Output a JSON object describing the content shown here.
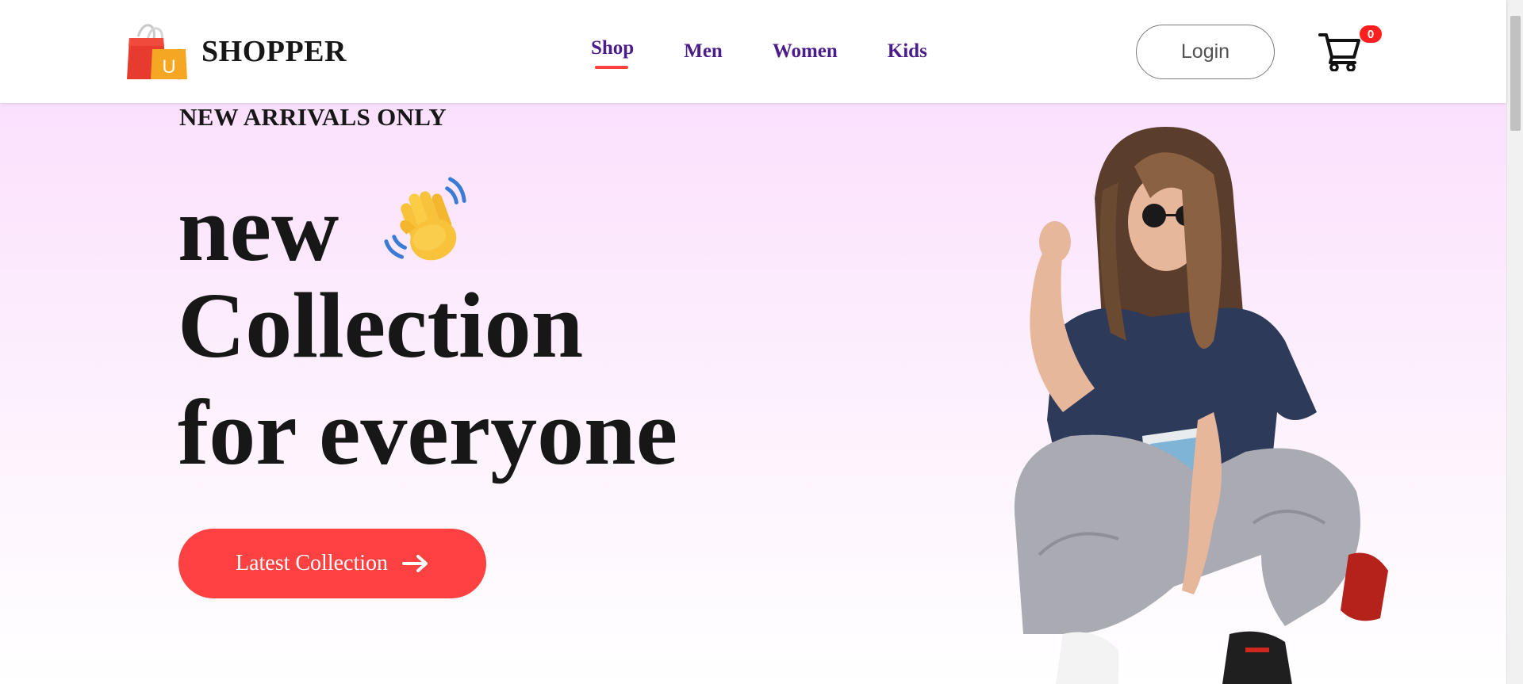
{
  "brand": {
    "name": "SHOPPER",
    "logo_badge": "U"
  },
  "nav": {
    "items": [
      {
        "label": "Shop",
        "active": true
      },
      {
        "label": "Men",
        "active": false
      },
      {
        "label": "Women",
        "active": false
      },
      {
        "label": "Kids",
        "active": false
      }
    ],
    "login_label": "Login",
    "cart_count": "0"
  },
  "hero": {
    "tag": "NEW ARRIVALS ONLY",
    "line1": "new",
    "line2": "Collection",
    "line3": "for everyone",
    "cta_label": "Latest Collection",
    "wave_icon": "waving-hand-icon",
    "arrow_icon": "arrow-right-icon",
    "image_icon": "hero-model-image"
  },
  "colors": {
    "accent": "#ff4141",
    "nav_text": "#4b1d8a",
    "hero_top": "#fbe0fd",
    "hero_bottom": "#ffffff",
    "heading": "#171717"
  }
}
